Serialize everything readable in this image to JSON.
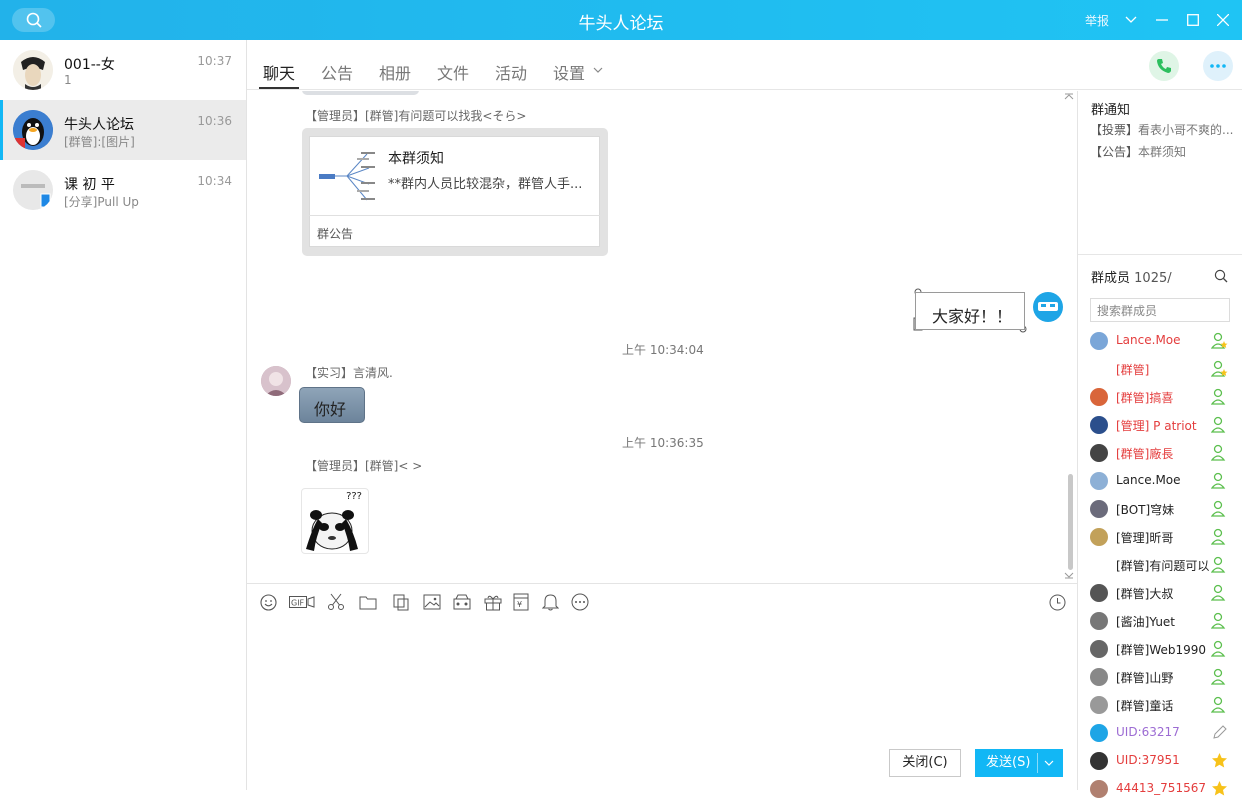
{
  "window": {
    "title": "牛头人论坛",
    "report_label": "举报"
  },
  "sessions": [
    {
      "name": "001--女",
      "preview": "1",
      "time": "10:37"
    },
    {
      "name": "牛头人论坛",
      "preview": "[群管]:[图片]",
      "time": "10:36"
    },
    {
      "name": "课 初 平",
      "preview": "[分享]Pull Up",
      "time": "10:34"
    }
  ],
  "tabs": [
    "聊天",
    "公告",
    "相册",
    "文件",
    "活动",
    "设置"
  ],
  "chat": {
    "msg1_sender": "【管理员】[群管]有问题可以找我<そら>",
    "card_title": "本群须知",
    "card_desc": "**群内人员比较混杂，群管人手...",
    "card_footer": "群公告",
    "self_message": "大家好！！",
    "time1": "上午 10:34:04",
    "msg2_sender": "【实习】言清风.",
    "msg2_text": "你好",
    "time2": "上午 10:36:35",
    "msg3_sender": "【管理员】[群管]<   >",
    "sticker_caption": "???"
  },
  "buttons": {
    "close": "关闭(C)",
    "send": "发送(S)"
  },
  "right_panel": {
    "notice_title": "群通知",
    "notices": [
      {
        "tag": "【投票】",
        "text": "看表小哥不爽的..."
      },
      {
        "tag": "【公告】",
        "text": "本群须知"
      }
    ],
    "members_label": "群成员",
    "members_count": "1025/",
    "member_search_placeholder": "搜索群成员",
    "members": [
      {
        "name": "Lance.Moe",
        "color": "#e43d3d"
      },
      {
        "name": "[群管]",
        "color": "#e43d3d"
      },
      {
        "name": "[群管]搞喜",
        "color": "#e43d3d"
      },
      {
        "name": "[管理] P atriot",
        "color": "#e43d3d"
      },
      {
        "name": "[群管]廠長",
        "color": "#e43d3d"
      },
      {
        "name": "Lance.Moe",
        "color": "#222222"
      },
      {
        "name": "[BOT]穹妹",
        "color": "#222222"
      },
      {
        "name": "[管理]昕哥",
        "color": "#222222"
      },
      {
        "name": "[群管]有问题可以",
        "color": "#222222"
      },
      {
        "name": "[群管]大叔",
        "color": "#222222"
      },
      {
        "name": "[酱油]Yuet",
        "color": "#222222"
      },
      {
        "name": "[群管]Web1990",
        "color": "#222222"
      },
      {
        "name": "[群管]山野",
        "color": "#222222"
      },
      {
        "name": "[群管]童话",
        "color": "#222222"
      },
      {
        "name": "UID:63217",
        "color": "#9c6bd3"
      },
      {
        "name": "UID:37951",
        "color": "#e43d3d"
      },
      {
        "name": "44413_751567",
        "color": "#e43d3d"
      }
    ]
  },
  "colors": {
    "accent": "#12b7f5",
    "titlebar": "#1fc4f4"
  }
}
